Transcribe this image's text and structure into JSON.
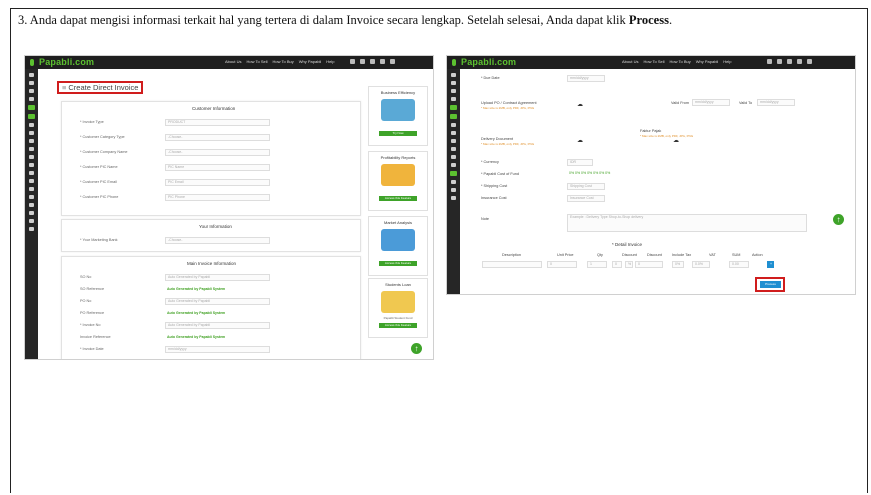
{
  "instruction": {
    "text": "3. Anda dapat mengisi informasi terkait hal yang tertera di dalam Invoice secara lengkap. Setelah selesai, Anda dapat klik ",
    "bold": "Process",
    "end": "."
  },
  "left": {
    "logo": "Papabli.com",
    "nav": [
      "About Us",
      "How To Sell",
      "How To Buy",
      "Why Papabli",
      "Help"
    ],
    "page_title": "Create Direct Invoice",
    "customer": {
      "title": "Customer Information",
      "rows": [
        {
          "label": "* Invoice Type",
          "value": "PRODUCT"
        },
        {
          "label": "* Customer Category Type",
          "value": "-Choose-"
        },
        {
          "label": "* Customer Company Name",
          "value": "-Choose-"
        },
        {
          "label": "* Customer PIC Name",
          "value": "PIC Name"
        },
        {
          "label": "* Customer PIC Email",
          "value": "PIC Email"
        },
        {
          "label": "* Customer PIC Phone",
          "value": "PIC Phone"
        }
      ]
    },
    "your": {
      "title": "Your Information",
      "rows": [
        {
          "label": "* Your Marketing Bank",
          "value": "-Choose-"
        }
      ]
    },
    "invoice": {
      "title": "Main Invoice Information",
      "rows": [
        {
          "label": "SO No",
          "value": "Auto Generated by Papabli"
        },
        {
          "label": "SO Reference",
          "value": "Auto Generated by Papabli System",
          "green": true
        },
        {
          "label": "PO No",
          "value": "Auto Generated by Papabli"
        },
        {
          "label": "PO Reference",
          "value": "Auto Generated by Papabli System",
          "green": true
        },
        {
          "label": "* Invoice No",
          "value": "Auto Generated by Papabli"
        },
        {
          "label": "Invoice Reference",
          "value": "Auto Generated by Papabli System",
          "green": true
        },
        {
          "label": "* Invoice Date",
          "value": "mm/dd/yyyy"
        }
      ]
    },
    "side_cards": [
      {
        "title": "Business Efficiency",
        "button": "Try Now"
      },
      {
        "title": "Profitability Reports",
        "button": "Access this Feature"
      },
      {
        "title": "Market Analysis",
        "button": "Access this Feature"
      },
      {
        "title": "Students Loan",
        "button": "Access this Feature",
        "caption": "Papabli Student Fund"
      }
    ]
  },
  "right": {
    "logo": "Papabli.com",
    "nav": [
      "About Us",
      "How To Sell",
      "How To Buy",
      "Why Papabli",
      "Help"
    ],
    "rows": [
      {
        "label": "* Due Date",
        "value": "mm/dd/yyyy"
      },
      {
        "label": "Upload PO / Contract Agreement",
        "sub": "* Max size is 2MB, only PDF, JPG, PNG"
      },
      {
        "label": "Delivery Document",
        "sub": "* Max size is 2MB, only PDF, JPG, PNG"
      },
      {
        "label": "* Currency",
        "value": "IDR"
      },
      {
        "label": "* Papabli Cost of Fund",
        "value": "0%   0%   0%   0%   0%   0%   0%"
      },
      {
        "label": "* Shipping Cost",
        "value": "Shipping Cost"
      },
      {
        "label": "Insurance Cost",
        "value": "Insurance Cost"
      },
      {
        "label": "Note",
        "value": "Example : Delivery Type Shop-to-Shop delivery"
      }
    ],
    "valid_from_label": "Valid From",
    "valid_from_value": "mm/dd/yyyy",
    "valid_to_label": "Valid To",
    "valid_to_value": "mm/dd/yyyy",
    "tax_paper_label": "Faktur Pajak",
    "tax_paper_sub": "* Max size is 2MB, only PDF, JPG, PNG",
    "detail_title": "* Detail Invoice",
    "detail_cols": [
      "Description",
      "Unit Price",
      "Qty",
      "Discount",
      "Discount",
      "Include Tax",
      "VAT",
      "SUM",
      "Action"
    ],
    "detail_row": [
      "",
      "0",
      "1",
      "0",
      "%",
      "0",
      "0%",
      "0.0%",
      "0.00",
      "+"
    ],
    "process_label": "Process"
  },
  "colors": {
    "accent_green": "#3ea329",
    "highlight_red": "#d01d1d",
    "topbar": "#1f1f1f"
  }
}
